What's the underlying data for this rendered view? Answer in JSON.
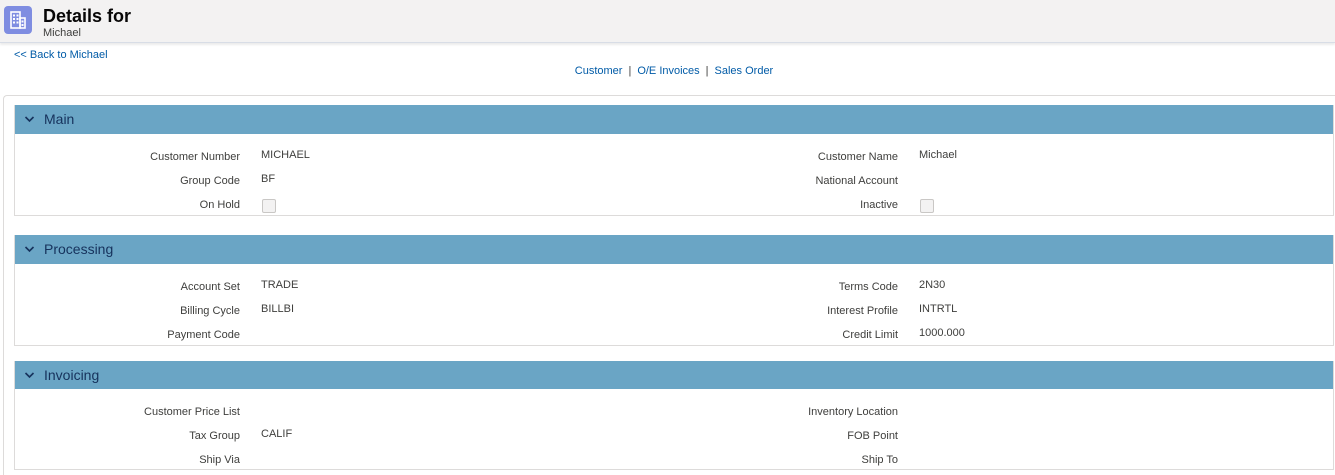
{
  "header": {
    "icon": "building-icon",
    "title": "Details for",
    "subtitle": "Michael"
  },
  "back_link": "<< Back to Michael",
  "nav": {
    "links": [
      "Customer",
      "O/E Invoices",
      "Sales Order"
    ],
    "separator": "|"
  },
  "sections": [
    {
      "title": "Main",
      "rows": [
        {
          "left_label": "Customer Number",
          "left_value": "MICHAEL",
          "right_label": "Customer Name",
          "right_value": "Michael"
        },
        {
          "left_label": "Group Code",
          "left_value": "BF",
          "right_label": "National Account",
          "right_value": ""
        },
        {
          "left_label": "On Hold",
          "left_checkbox": false,
          "right_label": "Inactive",
          "right_checkbox": false
        }
      ]
    },
    {
      "title": "Processing",
      "rows": [
        {
          "left_label": "Account Set",
          "left_value": "TRADE",
          "right_label": "Terms Code",
          "right_value": "2N30"
        },
        {
          "left_label": "Billing Cycle",
          "left_value": "BILLBI",
          "right_label": "Interest Profile",
          "right_value": "INTRTL"
        },
        {
          "left_label": "Payment Code",
          "left_value": "",
          "right_label": "Credit Limit",
          "right_value": "1000.000"
        }
      ]
    },
    {
      "title": "Invoicing",
      "rows": [
        {
          "left_label": "Customer Price List",
          "left_value": "",
          "right_label": "Inventory Location",
          "right_value": ""
        },
        {
          "left_label": "Tax Group",
          "left_value": "CALIF",
          "right_label": "FOB Point",
          "right_value": ""
        },
        {
          "left_label": "Ship Via",
          "left_value": "",
          "right_label": "Ship To",
          "right_value": ""
        }
      ]
    }
  ],
  "colors": {
    "section_header": "#6aa5c5",
    "link": "#015ba7",
    "icon_bg": "#7f8de1"
  }
}
